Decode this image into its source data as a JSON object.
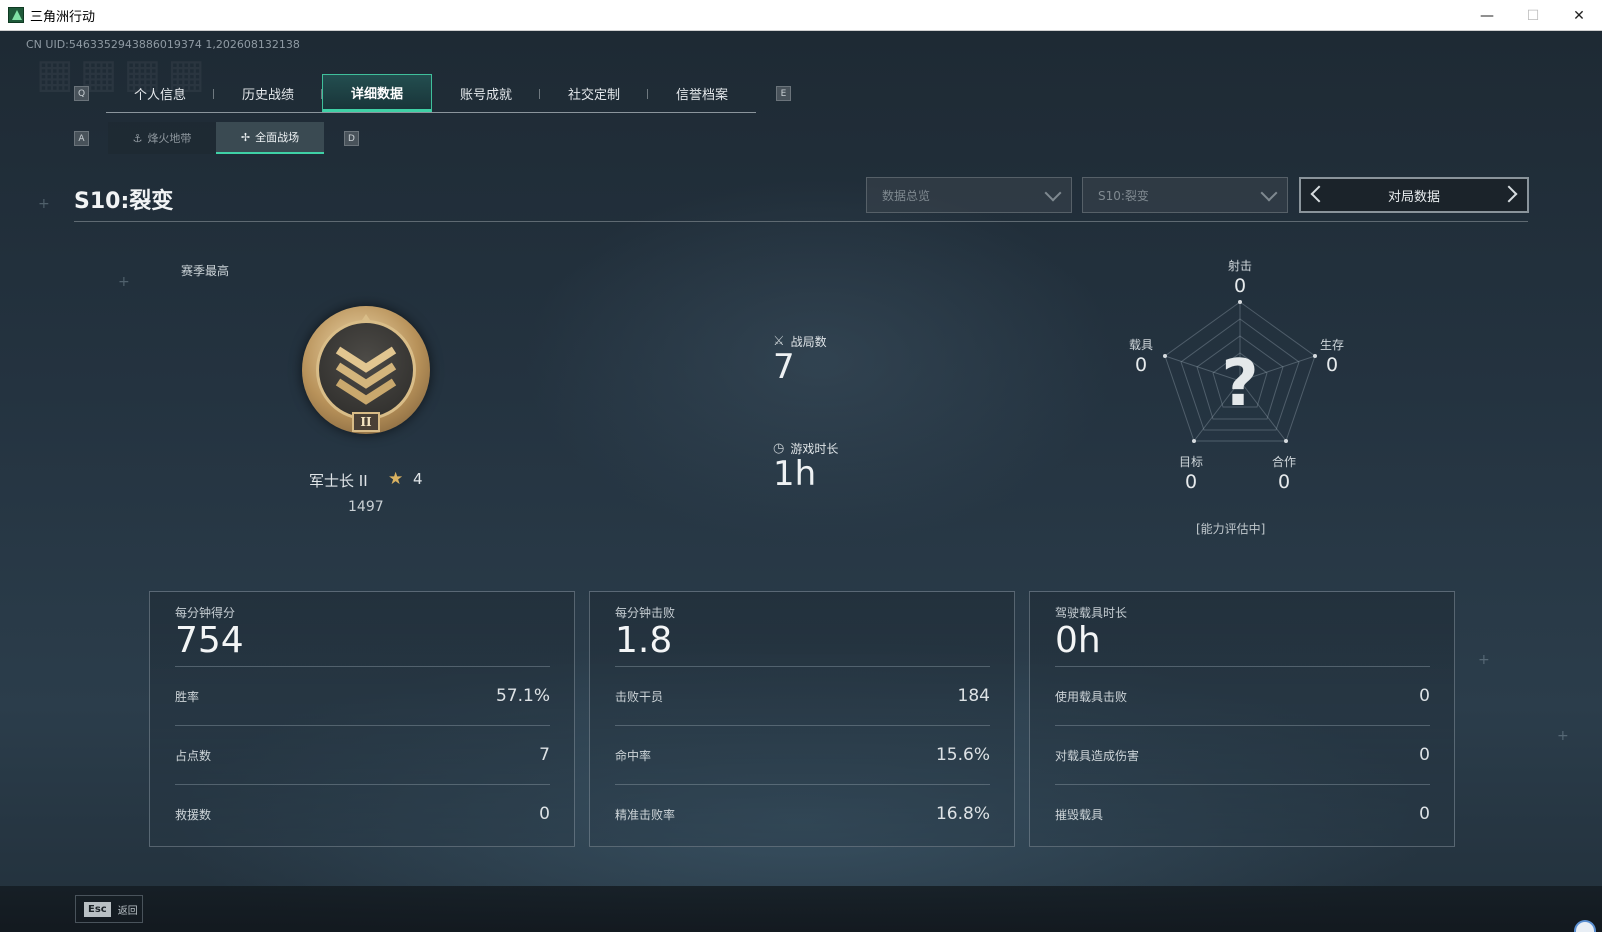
{
  "window": {
    "title": "三角洲行动",
    "minimize": "—",
    "maximize": "☐",
    "close": "✕"
  },
  "uid": "CN UID:5463352943886019374 1,202608132138",
  "tabs": {
    "key_left": "Q",
    "key_right": "E",
    "items": [
      {
        "label": "个人信息"
      },
      {
        "label": "历史战绩"
      },
      {
        "label": "详细数据"
      },
      {
        "label": "账号成就"
      },
      {
        "label": "社交定制"
      },
      {
        "label": "信誉档案"
      }
    ],
    "active_index": 2
  },
  "subtabs": {
    "key_left": "A",
    "key_right": "D",
    "items": [
      {
        "label": "烽火地带",
        "icon": "crosshair-icon"
      },
      {
        "label": "全面战场",
        "icon": "battlefield-icon"
      }
    ],
    "active_index": 1
  },
  "season_title": "S10:裂变",
  "filters": {
    "data_type": "数据总览",
    "season": "S10:裂变",
    "match_data": "对局数据"
  },
  "rank": {
    "section_label": "赛季最高",
    "name": "军士长 II",
    "roman": "II",
    "stars": "4",
    "score": "1497"
  },
  "summary": {
    "matches_label": "战局数",
    "matches_value": "7",
    "playtime_label": "游戏时长",
    "playtime_value": "1h"
  },
  "radar": {
    "center_mark": "?",
    "note": "[能力评估中]",
    "axes": [
      {
        "label": "射击",
        "value": "0"
      },
      {
        "label": "生存",
        "value": "0"
      },
      {
        "label": "合作",
        "value": "0"
      },
      {
        "label": "目标",
        "value": "0"
      },
      {
        "label": "载具",
        "value": "0"
      }
    ]
  },
  "cards": [
    {
      "title": "每分钟得分",
      "main": "754",
      "rows": [
        {
          "label": "胜率",
          "value": "57.1%"
        },
        {
          "label": "占点数",
          "value": "7"
        },
        {
          "label": "救援数",
          "value": "0"
        }
      ]
    },
    {
      "title": "每分钟击败",
      "main": "1.8",
      "rows": [
        {
          "label": "击败干员",
          "value": "184"
        },
        {
          "label": "命中率",
          "value": "15.6%"
        },
        {
          "label": "精准击败率",
          "value": "16.8%"
        }
      ]
    },
    {
      "title": "驾驶载具时长",
      "main": "0h",
      "rows": [
        {
          "label": "使用载具击败",
          "value": "0"
        },
        {
          "label": "对载具造成伤害",
          "value": "0"
        },
        {
          "label": "摧毁载具",
          "value": "0"
        }
      ]
    }
  ],
  "bottom": {
    "esc_key": "Esc",
    "esc_label": "返回"
  }
}
